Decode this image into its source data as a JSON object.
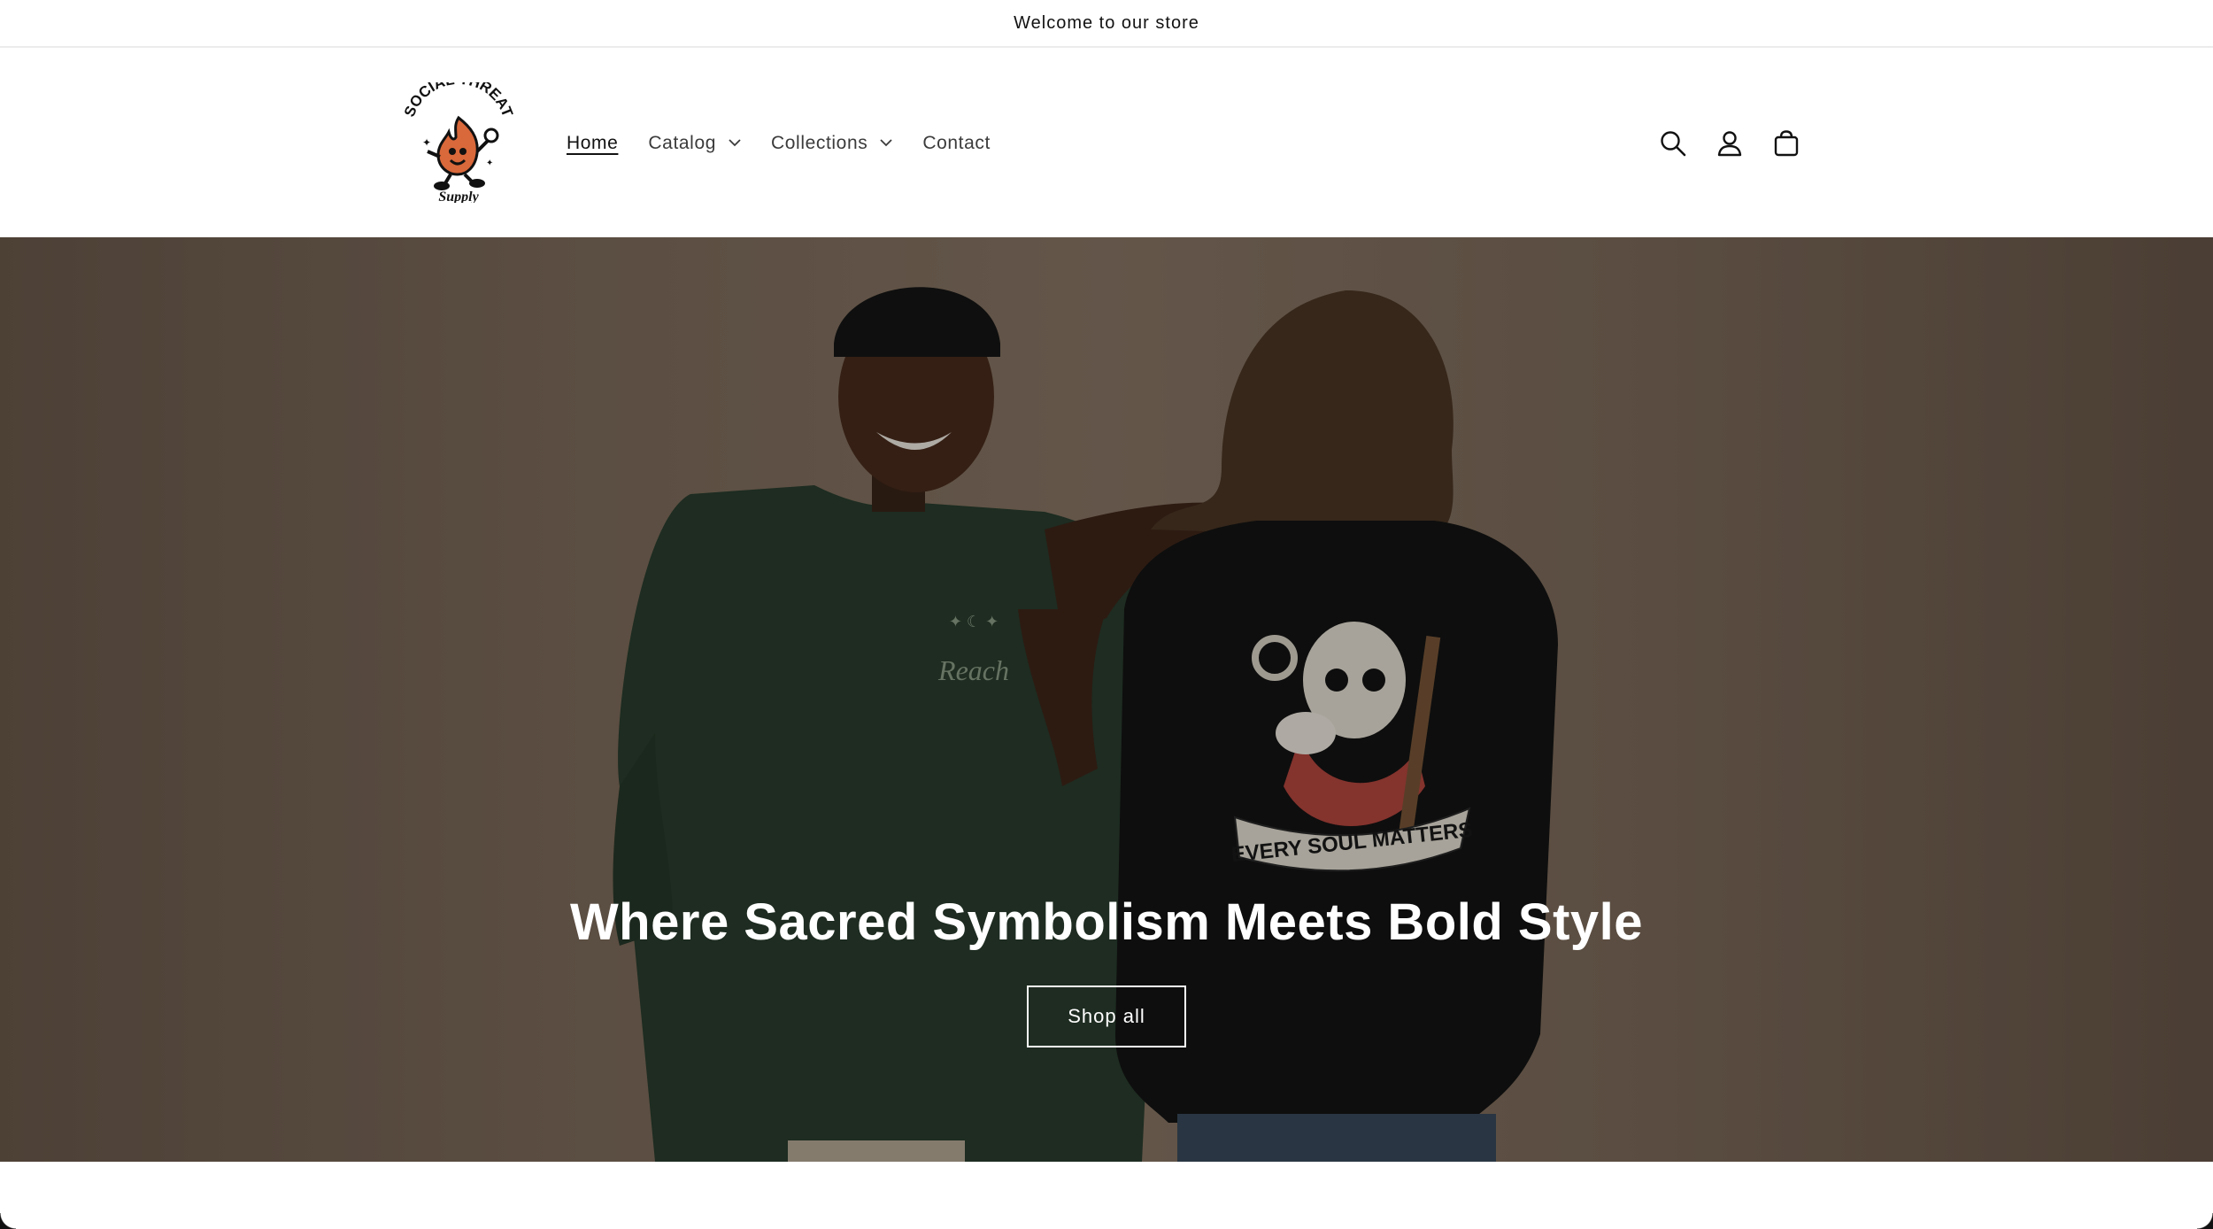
{
  "announcement": {
    "text": "Welcome to our store"
  },
  "logo": {
    "alt": "Social Threat Supply logo",
    "lettering_top": "SOCIAL THREAT",
    "lettering_bottom": "Supply",
    "icon": "flame-mascot-logo"
  },
  "nav": {
    "items": [
      {
        "label": "Home",
        "active": true,
        "dropdown": false
      },
      {
        "label": "Catalog",
        "active": false,
        "dropdown": true
      },
      {
        "label": "Collections",
        "active": false,
        "dropdown": true
      },
      {
        "label": "Contact",
        "active": false,
        "dropdown": false
      }
    ]
  },
  "header_icons": [
    "search-icon",
    "account-icon",
    "cart-icon"
  ],
  "hero": {
    "title": "Where Sacred Symbolism Meets Bold Style",
    "button_label": "Shop all",
    "image_alt": "Two models wearing Social Threat Supply shirts",
    "shirt_print_front": "Reach",
    "shirt_print_back": "EVERY SOUL MATTERS"
  },
  "colors": {
    "text": "#121212",
    "hero_bg": "#7e6b5b",
    "shirt_green": "#2a3d2e",
    "shirt_black": "#141414",
    "logo_orange": "#d9683a"
  }
}
